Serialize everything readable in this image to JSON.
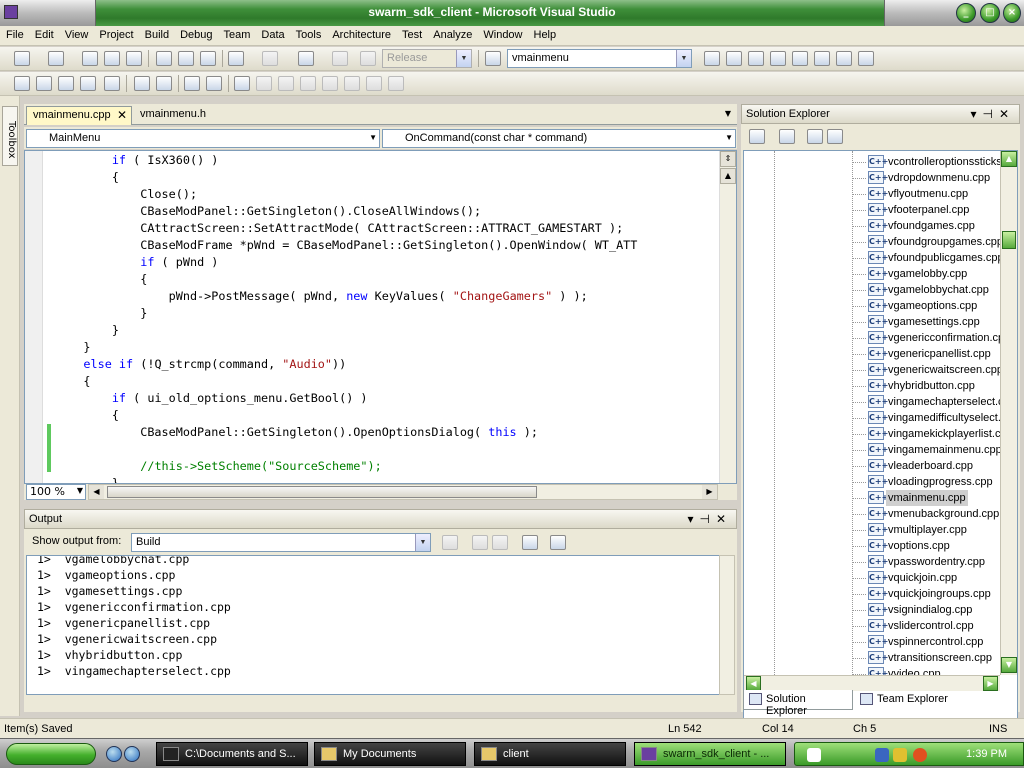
{
  "window": {
    "title": "swarm_sdk_client - Microsoft Visual Studio"
  },
  "menu": [
    "File",
    "Edit",
    "View",
    "Project",
    "Build",
    "Debug",
    "Team",
    "Data",
    "Tools",
    "Architecture",
    "Test",
    "Analyze",
    "Window",
    "Help"
  ],
  "toolbar": {
    "config": "Release",
    "find_combo": "vmainmenu"
  },
  "sidebar": {
    "toolbox_label": "Toolbox"
  },
  "editor": {
    "tabs": [
      {
        "label": "vmainmenu.cpp",
        "active": true
      },
      {
        "label": "vmainmenu.h",
        "active": false
      }
    ],
    "nav_left": "MainMenu",
    "nav_right": "OnCommand(const char * command)",
    "zoom": "100 %",
    "lines": [
      [
        {
          "t": "        "
        },
        {
          "t": "if",
          "c": "kw"
        },
        {
          "t": " ( IsX360() )"
        }
      ],
      [
        {
          "t": "        {"
        }
      ],
      [
        {
          "t": "            Close();"
        }
      ],
      [
        {
          "t": "            CBaseModPanel::GetSingleton().CloseAllWindows();"
        }
      ],
      [
        {
          "t": "            CAttractScreen::SetAttractMode( CAttractScreen::ATTRACT_GAMESTART );"
        }
      ],
      [
        {
          "t": "            CBaseModFrame *pWnd = CBaseModPanel::GetSingleton().OpenWindow( WT_ATT"
        }
      ],
      [
        {
          "t": "            "
        },
        {
          "t": "if",
          "c": "kw"
        },
        {
          "t": " ( pWnd )"
        }
      ],
      [
        {
          "t": "            {"
        }
      ],
      [
        {
          "t": "                pWnd->PostMessage( pWnd, "
        },
        {
          "t": "new",
          "c": "kw"
        },
        {
          "t": " KeyValues( "
        },
        {
          "t": "\"ChangeGamers\"",
          "c": "str"
        },
        {
          "t": " ) );"
        }
      ],
      [
        {
          "t": "            }"
        }
      ],
      [
        {
          "t": "        }"
        }
      ],
      [
        {
          "t": "    }"
        }
      ],
      [
        {
          "t": "    "
        },
        {
          "t": "else if",
          "c": "kw"
        },
        {
          "t": " (!Q_strcmp(command, "
        },
        {
          "t": "\"Audio\"",
          "c": "str"
        },
        {
          "t": "))"
        }
      ],
      [
        {
          "t": "    {"
        }
      ],
      [
        {
          "t": "        "
        },
        {
          "t": "if",
          "c": "kw"
        },
        {
          "t": " ( ui_old_options_menu.GetBool() )"
        }
      ],
      [
        {
          "t": "        {"
        }
      ],
      [
        {
          "t": "            CBaseModPanel::GetSingleton().OpenOptionsDialog( "
        },
        {
          "t": "this",
          "c": "kw"
        },
        {
          "t": " );"
        }
      ],
      [
        {
          "t": ""
        }
      ],
      [
        {
          "t": "            "
        },
        {
          "t": "//this->SetScheme(\"SourceScheme\");",
          "c": "cmt"
        }
      ],
      [
        {
          "t": "        }"
        }
      ]
    ]
  },
  "output": {
    "title": "Output",
    "show_output_label": "Show output from:",
    "source": "Build",
    "lines": [
      "1>  vgamelobbychat.cpp",
      "1>  vgameoptions.cpp",
      "1>  vgamesettings.cpp",
      "1>  vgenericconfirmation.cpp",
      "1>  vgenericpanellist.cpp",
      "1>  vgenericwaitscreen.cpp",
      "1>  vhybridbutton.cpp",
      "1>  vingamechapterselect.cpp"
    ]
  },
  "solution": {
    "title": "Solution Explorer",
    "icon_label": "C++",
    "files": [
      "vcontrolleroptionssticks",
      "vdropdownmenu.cpp",
      "vflyoutmenu.cpp",
      "vfooterpanel.cpp",
      "vfoundgames.cpp",
      "vfoundgroupgames.cpp",
      "vfoundpublicgames.cpp",
      "vgamelobby.cpp",
      "vgamelobbychat.cpp",
      "vgameoptions.cpp",
      "vgamesettings.cpp",
      "vgenericconfirmation.cpp",
      "vgenericpanellist.cpp",
      "vgenericwaitscreen.cpp",
      "vhybridbutton.cpp",
      "vingamechapterselect.cpp",
      "vingamedifficultyselect.",
      "vingamekickplayerlist.cp",
      "vingamemainmenu.cpp",
      "vleaderboard.cpp",
      "vloadingprogress.cpp",
      "vmainmenu.cpp",
      "vmenubackground.cpp",
      "vmultiplayer.cpp",
      "voptions.cpp",
      "vpasswordentry.cpp",
      "vquickjoin.cpp",
      "vquickjoingroups.cpp",
      "vsignindialog.cpp",
      "vslidercontrol.cpp",
      "vspinnercontrol.cpp",
      "vtransitionscreen.cpp",
      "vvideo.cpp"
    ],
    "selected": "vmainmenu.cpp",
    "tabs": [
      "Solution Explorer",
      "Team Explorer"
    ]
  },
  "status": {
    "message": "Item(s) Saved",
    "line": "Ln 542",
    "col": "Col 14",
    "ch": "Ch 5",
    "mode": "INS"
  },
  "taskbar": {
    "buttons": [
      {
        "label": "C:\\Documents and S...",
        "active": false
      },
      {
        "label": "My Documents",
        "active": false
      },
      {
        "label": "client",
        "active": false
      },
      {
        "label": "swarm_sdk_client - ...",
        "active": true
      }
    ],
    "clock": "1:39 PM"
  }
}
